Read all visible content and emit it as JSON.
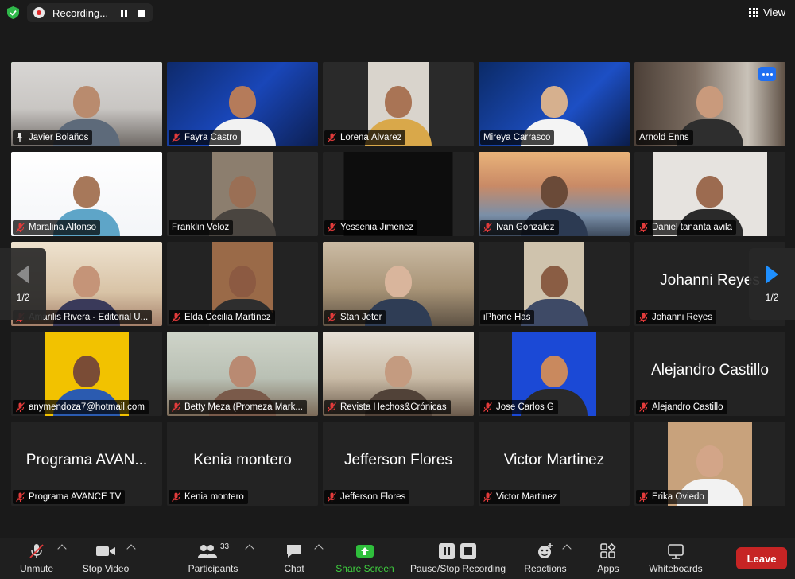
{
  "top_bar": {
    "recording_label": "Recording...",
    "view_label": "View"
  },
  "pager": {
    "left_label": "1/2",
    "right_label": "1/2"
  },
  "participants": [
    {
      "name": "Javier Bolaños",
      "big": "",
      "muted": false,
      "pinned": true,
      "active": true,
      "video": "office"
    },
    {
      "name": "Fayra Castro",
      "big": "",
      "muted": true,
      "video": "blue-banner"
    },
    {
      "name": "Lorena Álvarez",
      "big": "",
      "muted": true,
      "video": "portrait-light"
    },
    {
      "name": "Mireya Carrasco",
      "big": "",
      "muted": false,
      "video": "blue-banner2"
    },
    {
      "name": "Arnold Enns",
      "big": "",
      "muted": false,
      "video": "bookshelf",
      "more": true
    },
    {
      "name": "Maralina Alfonso",
      "big": "",
      "muted": true,
      "video": "white-logo"
    },
    {
      "name": "Franklin Veloz",
      "big": "",
      "muted": false,
      "video": "portrait-dim"
    },
    {
      "name": "Yessenia Jimenez",
      "big": "",
      "muted": true,
      "video": "dark"
    },
    {
      "name": "Ivan Gonzalez",
      "big": "",
      "muted": true,
      "video": "sunset"
    },
    {
      "name": "Daniel tananta avila",
      "big": "",
      "muted": true,
      "video": "white-wall"
    },
    {
      "name": "Amarilis Rivera - Editorial U...",
      "big": "",
      "muted": true,
      "video": "warm-room"
    },
    {
      "name": "Elda Cecilia Martínez",
      "big": "",
      "muted": true,
      "video": "portrait-wood"
    },
    {
      "name": "Stan Jeter",
      "big": "",
      "muted": true,
      "video": "living-room"
    },
    {
      "name": "iPhone Has",
      "big": "",
      "muted": false,
      "video": "portrait-cream"
    },
    {
      "name": "Johanni Reyes",
      "big": "Johanni Reyes",
      "muted": true,
      "video": "none"
    },
    {
      "name": "anymendoza7@hotmail.com",
      "big": "",
      "muted": true,
      "video": "flag"
    },
    {
      "name": "Betty Meza (Promeza Mark...",
      "big": "",
      "muted": true,
      "video": "classroom"
    },
    {
      "name": "Revista Hechos&Crónicas",
      "big": "",
      "muted": true,
      "video": "window-room"
    },
    {
      "name": "Jose Carlos G",
      "big": "",
      "muted": true,
      "video": "avatar"
    },
    {
      "name": "Alejandro Castillo",
      "big": "Alejandro Castillo",
      "muted": true,
      "video": "none"
    },
    {
      "name": "Programa AVANCE TV",
      "big": "Programa AVAN...",
      "muted": true,
      "video": "none"
    },
    {
      "name": "Kenia montero",
      "big": "Kenia montero",
      "muted": true,
      "video": "none"
    },
    {
      "name": "Jefferson Flores",
      "big": "Jefferson Flores",
      "muted": true,
      "video": "none"
    },
    {
      "name": "Victor Martinez",
      "big": "Victor Martinez",
      "muted": true,
      "video": "none"
    },
    {
      "name": "Erika Oviedo",
      "big": "",
      "muted": true,
      "video": "portrait-tan"
    }
  ],
  "toolbar": {
    "unmute": "Unmute",
    "stop_video": "Stop Video",
    "participants": "Participants",
    "participants_count": "33",
    "chat": "Chat",
    "share_screen": "Share Screen",
    "record": "Pause/Stop Recording",
    "reactions": "Reactions",
    "apps": "Apps",
    "whiteboards": "Whiteboards",
    "leave": "Leave"
  },
  "colors": {
    "active_speaker": "#3fce3f",
    "share_green": "#3fd23f",
    "leave_red": "#c62424",
    "accent_blue": "#1f6ff2"
  }
}
